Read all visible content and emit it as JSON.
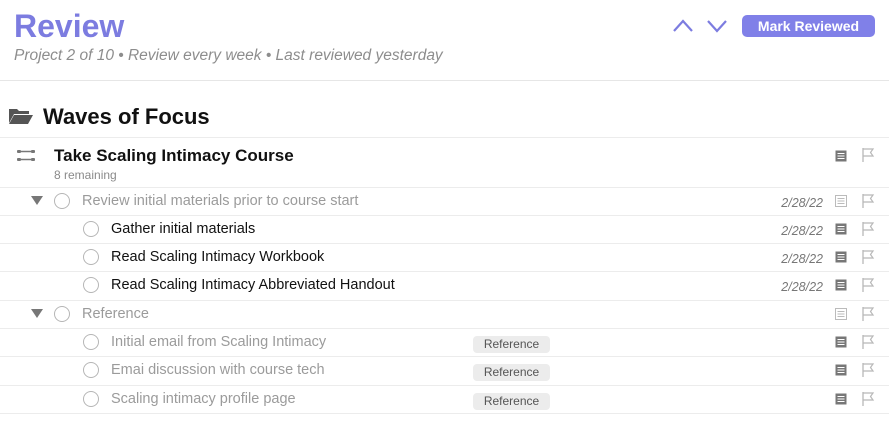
{
  "header": {
    "title": "Review",
    "subtitle": "Project 2 of 10 • Review every week • Last reviewed yesterday",
    "mark_reviewed_label": "Mark Reviewed"
  },
  "folder": {
    "name": "Waves of Focus"
  },
  "project": {
    "name": "Take Scaling Intimacy Course",
    "remaining": "8 remaining"
  },
  "rows": [
    {
      "label": "Review initial materials prior to course start",
      "date": "2/28/22",
      "tag": ""
    },
    {
      "label": "Gather initial materials",
      "date": "2/28/22",
      "tag": ""
    },
    {
      "label": "Read Scaling Intimacy Workbook",
      "date": "2/28/22",
      "tag": ""
    },
    {
      "label": "Read Scaling Intimacy Abbreviated Handout",
      "date": "2/28/22",
      "tag": ""
    },
    {
      "label": "Reference",
      "date": "",
      "tag": ""
    },
    {
      "label": "Initial email from Scaling Intimacy",
      "date": "",
      "tag": "Reference"
    },
    {
      "label": "Emai discussion with course tech",
      "date": "",
      "tag": "Reference"
    },
    {
      "label": "Scaling intimacy profile page",
      "date": "",
      "tag": "Reference"
    }
  ],
  "colors": {
    "accent": "#7c7ce0",
    "button": "#8080e8"
  },
  "icons": [
    "chevron-up-icon",
    "chevron-down-icon",
    "folder-icon",
    "project-parallel-icon",
    "note-icon",
    "flag-icon"
  ]
}
